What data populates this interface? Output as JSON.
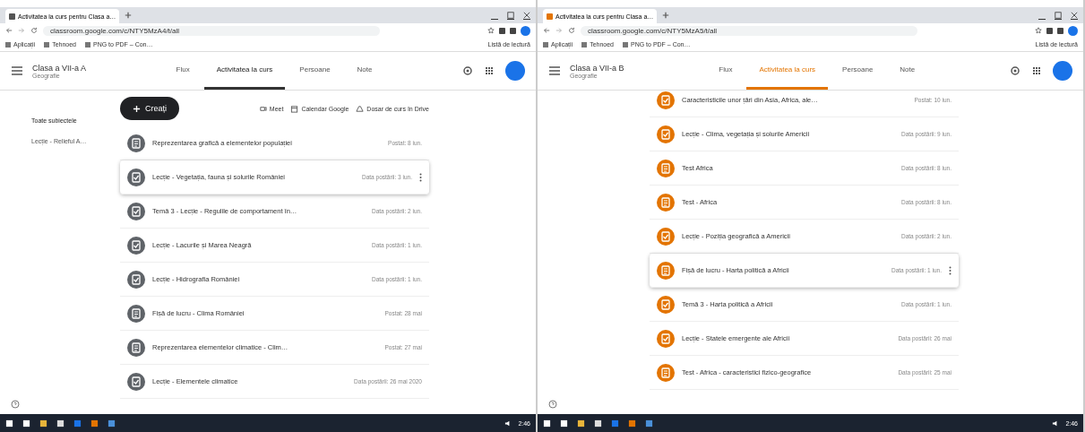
{
  "windows": [
    {
      "tab_title": "Activitatea la curs pentru Clasa a…",
      "url": "classroom.google.com/c/NTY5MzA4/t/all",
      "bookmarks": [
        "Aplicații",
        "Tehnoed",
        "PNG to PDF – Con…"
      ],
      "reading_list": "Listă de lectură",
      "class_name": "Clasa a VII-a A",
      "subject": "Geografie",
      "nav_tabs": [
        {
          "label": "Flux",
          "selected": false
        },
        {
          "label": "Activitatea la curs",
          "selected": true
        },
        {
          "label": "Persoane",
          "selected": false
        },
        {
          "label": "Note",
          "selected": false
        }
      ],
      "create_button": "Creați",
      "links": [
        "Meet",
        "Calendar Google",
        "Dosar de curs în Drive"
      ],
      "topics": [
        {
          "label": "Toate subiectele",
          "selected": true
        },
        {
          "label": "Lecție - Relieful A…",
          "selected": false
        }
      ],
      "items": [
        {
          "kind": "material",
          "title": "Reprezentarea grafică a elementelor populației",
          "date": "Postat: 8 iun.",
          "hovered": false
        },
        {
          "kind": "assignment",
          "title": "Lecție - Vegetația, fauna și solurile României",
          "date": "Data postării: 3 iun.",
          "hovered": true
        },
        {
          "kind": "assignment",
          "title": "Temă 3 - Lecție - Regulile de comportament în…",
          "date": "Data postării: 2 iun.",
          "hovered": false
        },
        {
          "kind": "assignment",
          "title": "Lecție - Lacurile și Marea Neagră",
          "date": "Data postării: 1 iun.",
          "hovered": false
        },
        {
          "kind": "assignment",
          "title": "Lecție - Hidrografia României",
          "date": "Data postării: 1 iun.",
          "hovered": false
        },
        {
          "kind": "material",
          "title": "Fișă de lucru - Clima României",
          "date": "Postat: 28 mai",
          "hovered": false
        },
        {
          "kind": "material",
          "title": "Reprezentarea elementelor climatice - Clim…",
          "date": "Postat: 27 mai",
          "hovered": false
        },
        {
          "kind": "assignment",
          "title": "Lecție - Elementele climatice",
          "date": "Data postării: 26 mai 2020",
          "hovered": false
        }
      ]
    },
    {
      "tab_title": "Activitatea la curs pentru Clasa a…",
      "url": "classroom.google.com/c/NTY5MzA5/t/all",
      "bookmarks": [
        "Aplicații",
        "Tehnoed",
        "PNG to PDF – Con…"
      ],
      "reading_list": "Listă de lectură",
      "class_name": "Clasa a VII-a B",
      "subject": "Geografie",
      "nav_tabs": [
        {
          "label": "Flux",
          "selected": false
        },
        {
          "label": "Activitatea la curs",
          "selected": true
        },
        {
          "label": "Persoane",
          "selected": false
        },
        {
          "label": "Note",
          "selected": false
        }
      ],
      "items": [
        {
          "kind": "assignment",
          "title": "Caracteristicile unor țări din Asia, Africa, ale…",
          "date": "Postat: 10 iun.",
          "hovered": false
        },
        {
          "kind": "assignment",
          "title": "Lecție - Clima, vegetația și solurile Americii",
          "date": "Data postării: 9 iun.",
          "hovered": false
        },
        {
          "kind": "material",
          "title": "Test Africa",
          "date": "Data postării: 8 iun.",
          "hovered": false
        },
        {
          "kind": "material",
          "title": "Test - Africa",
          "date": "Data postării: 8 iun.",
          "hovered": false
        },
        {
          "kind": "assignment",
          "title": "Lecție - Poziția geografică a Americii",
          "date": "Data postării: 2 iun.",
          "hovered": false
        },
        {
          "kind": "material",
          "title": "Fișă de lucru - Harta politică a Africii",
          "date": "Data postării: 1 iun.",
          "hovered": true
        },
        {
          "kind": "assignment",
          "title": "Temă 3 - Harta politică a Africii",
          "date": "Data postării: 1 iun.",
          "hovered": false
        },
        {
          "kind": "assignment",
          "title": "Lecție - Statele emergente ale Africii",
          "date": "Data postării: 26 mai",
          "hovered": false
        },
        {
          "kind": "material",
          "title": "Test - Africa - caracteristici fizico-geografice",
          "date": "Data postării: 25 mai",
          "hovered": false
        }
      ]
    }
  ],
  "taskbars": [
    {
      "time": "2:46"
    },
    {
      "time": "2:46"
    }
  ]
}
